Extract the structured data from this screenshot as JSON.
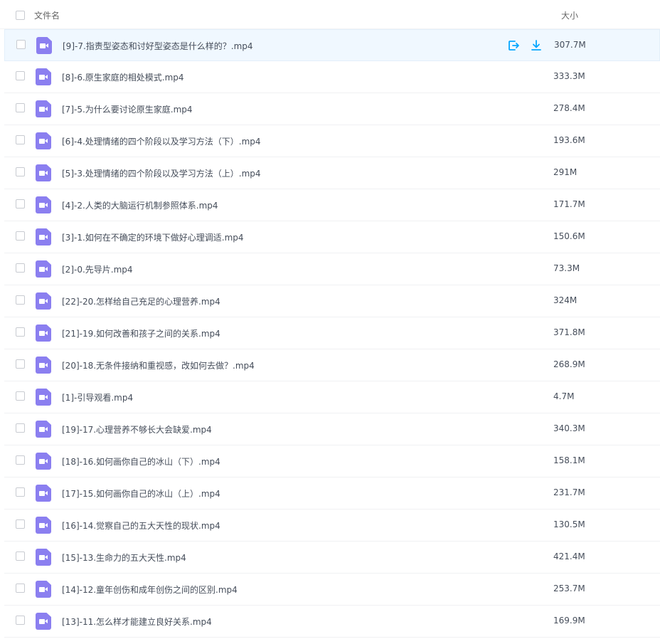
{
  "header": {
    "name_label": "文件名",
    "size_label": "大小"
  },
  "accent_color": "#06a7ff",
  "icon_color": "#8b7ff0",
  "hover_row_actions": {
    "share_icon": "share-out-icon",
    "download_icon": "download-icon"
  },
  "files": [
    {
      "name": "[9]-7.指责型姿态和讨好型姿态是什么样的？.mp4",
      "size": "307.7M"
    },
    {
      "name": "[8]-6.原生家庭的相处模式.mp4",
      "size": "333.3M"
    },
    {
      "name": "[7]-5.为什么要讨论原生家庭.mp4",
      "size": "278.4M"
    },
    {
      "name": "[6]-4.处理情绪的四个阶段以及学习方法（下）.mp4",
      "size": "193.6M"
    },
    {
      "name": "[5]-3.处理情绪的四个阶段以及学习方法（上）.mp4",
      "size": "291M"
    },
    {
      "name": "[4]-2.人类的大脑运行机制参照体系.mp4",
      "size": "171.7M"
    },
    {
      "name": "[3]-1.如何在不确定的环境下做好心理调适.mp4",
      "size": "150.6M"
    },
    {
      "name": "[2]-0.先导片.mp4",
      "size": "73.3M"
    },
    {
      "name": "[22]-20.怎样给自己充足的心理营养.mp4",
      "size": "324M"
    },
    {
      "name": "[21]-19.如何改善和孩子之间的关系.mp4",
      "size": "371.8M"
    },
    {
      "name": "[20]-18.无条件接纳和重视感，改如何去做？.mp4",
      "size": "268.9M"
    },
    {
      "name": "[1]-引导观看.mp4",
      "size": "4.7M"
    },
    {
      "name": "[19]-17.心理营养不够长大会缺爱.mp4",
      "size": "340.3M"
    },
    {
      "name": "[18]-16.如何画你自己的冰山（下）.mp4",
      "size": "158.1M"
    },
    {
      "name": "[17]-15.如何画你自己的冰山（上）.mp4",
      "size": "231.7M"
    },
    {
      "name": "[16]-14.觉察自己的五大天性的现状.mp4",
      "size": "130.5M"
    },
    {
      "name": "[15]-13.生命力的五大天性.mp4",
      "size": "421.4M"
    },
    {
      "name": "[14]-12.童年创伤和成年创伤之间的区别.mp4",
      "size": "253.7M"
    },
    {
      "name": "[13]-11.怎么样才能建立良好关系.mp4",
      "size": "169.9M"
    }
  ]
}
